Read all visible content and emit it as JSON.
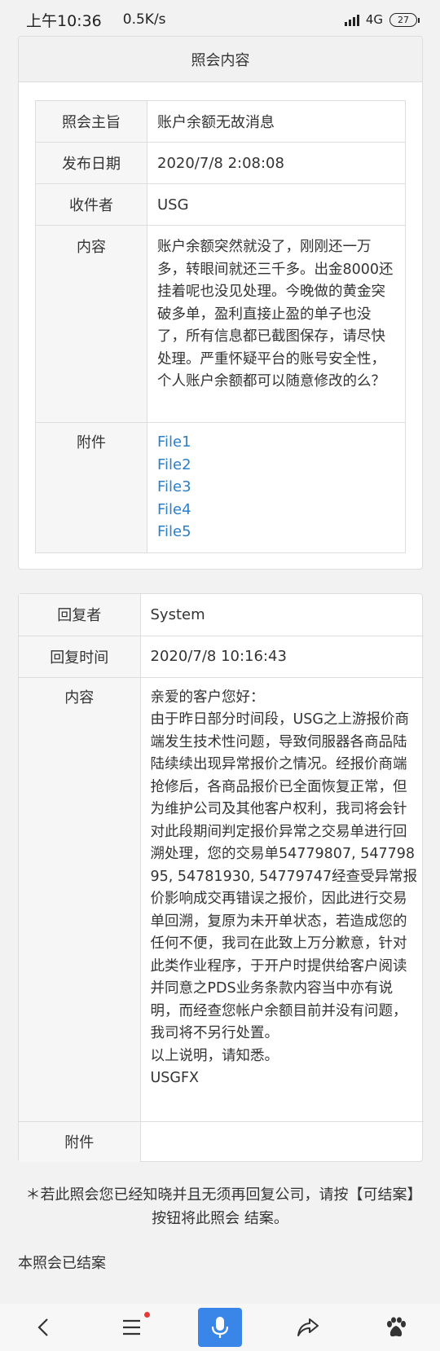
{
  "status_bar": {
    "time": "上午10:36",
    "speed": "0.5K/s",
    "network": "4G",
    "battery": "27"
  },
  "inquiry": {
    "header": "照会内容",
    "rows": {
      "subject_label": "照会主旨",
      "subject_value": "账户余额无故消息",
      "date_label": "发布日期",
      "date_value": "2020/7/8 2:08:08",
      "recipient_label": "收件者",
      "recipient_value": "USG",
      "content_label": "内容",
      "content_value": "账户余额突然就没了，刚刚还一万多，转眼间就还三千多。出金8000还挂着呢也没见处理。今晚做的黄金突破多单，盈利直接止盈的单子也没了，所有信息都已截图保存，请尽快处理。严重怀疑平台的账号安全性，个人账户余额都可以随意修改的么？",
      "attachment_label": "附件",
      "files": [
        "File1",
        "File2",
        "File3",
        "File4",
        "File5"
      ]
    }
  },
  "reply": {
    "replier_label": "回复者",
    "replier_value": "System",
    "time_label": "回复时间",
    "time_value": "2020/7/8 10:16:43",
    "content_label": "内容",
    "greeting": "亲爱的客户您好：",
    "body": "由于昨日部分时间段，USG之上游报价商端发生技术性问题，导致伺服器各商品陆陆续续出现异常报价之情况。经报价商端抢修后，各商品报价已全面恢复正常，但为维护公司及其他客户权利，我司将会针对此段期间判定报价异常之交易单进行回溯处理，您的交易单54779807, 54779895, 54781930, 54779747经查受异常报价影响成交再错误之报价，因此进行交易单回溯，复原为未开单状态，若造成您的任何不便，我司在此致上万分歉意，针对此类作业程序，于开户时提供给客户阅读并同意之PDS业务条款内容当中亦有说明，而经查您帐户余额目前并没有问题，我司将不另行处置。",
    "closing": "以上说明，请知悉。",
    "signature": "USGFX",
    "attachment_label": "附件"
  },
  "notice_text": "＊若此照会您已经知晓并且无须再回复公司，请按【可结案】按钮将此照会 结案。",
  "closed_text": "本照会已结案",
  "bottom_nav": [
    "back-icon",
    "menu-icon",
    "microphone-icon",
    "share-icon",
    "baidu-paw-icon"
  ],
  "colors": {
    "link": "#2c7fc9",
    "mic_button": "#3a86e8",
    "badge_dot": "#e53935"
  }
}
